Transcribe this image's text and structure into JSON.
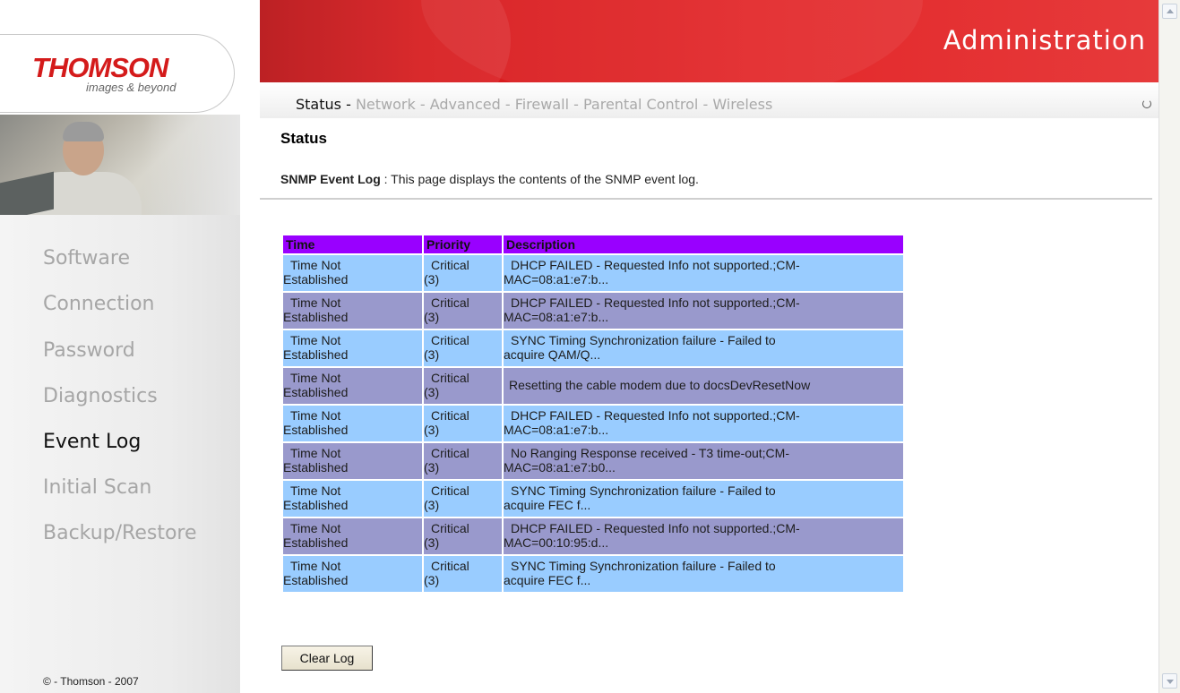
{
  "brand": {
    "logo_text": "THOMSON",
    "tagline": "images & beyond",
    "accent_color": "#d41b1b"
  },
  "header": {
    "title": "Administration"
  },
  "top_nav": {
    "items": [
      {
        "label": "Status",
        "active": true
      },
      {
        "label": "Network",
        "active": false
      },
      {
        "label": "Advanced",
        "active": false
      },
      {
        "label": "Firewall",
        "active": false
      },
      {
        "label": "Parental Control",
        "active": false
      },
      {
        "label": "Wireless",
        "active": false
      }
    ],
    "separator": " - "
  },
  "sidebar": {
    "items": [
      {
        "label": "Software",
        "active": false
      },
      {
        "label": "Connection",
        "active": false
      },
      {
        "label": "Password",
        "active": false
      },
      {
        "label": "Diagnostics",
        "active": false
      },
      {
        "label": "Event Log",
        "active": true
      },
      {
        "label": "Initial Scan",
        "active": false
      },
      {
        "label": "Backup/Restore",
        "active": false
      }
    ],
    "copyright": "© - Thomson - 2007"
  },
  "main": {
    "section_title": "Status",
    "page_name": "SNMP Event Log",
    "page_desc": ":  This page displays the contents of the SNMP event log.",
    "table": {
      "headers": [
        "Time",
        "Priority",
        "Description"
      ],
      "header_color": "#9900ff",
      "row_colors": [
        "#99ccff",
        "#9999cc"
      ],
      "rows": [
        {
          "time": [
            "Time Not",
            "Established"
          ],
          "priority": [
            "Critical",
            "(3)"
          ],
          "description": [
            "DHCP FAILED - Requested Info not supported.;CM-",
            "MAC=08:a1:e7:b..."
          ]
        },
        {
          "time": [
            "Time Not",
            "Established"
          ],
          "priority": [
            "Critical",
            "(3)"
          ],
          "description": [
            "DHCP FAILED - Requested Info not supported.;CM-",
            "MAC=08:a1:e7:b..."
          ]
        },
        {
          "time": [
            "Time Not",
            "Established"
          ],
          "priority": [
            "Critical",
            "(3)"
          ],
          "description": [
            "SYNC Timing Synchronization failure - Failed to",
            "acquire QAM/Q..."
          ]
        },
        {
          "time": [
            "Time Not",
            "Established"
          ],
          "priority": [
            "Critical",
            "(3)"
          ],
          "description": [
            "Resetting the cable modem due to docsDevResetNow"
          ]
        },
        {
          "time": [
            "Time Not",
            "Established"
          ],
          "priority": [
            "Critical",
            "(3)"
          ],
          "description": [
            "DHCP FAILED - Requested Info not supported.;CM-",
            "MAC=08:a1:e7:b..."
          ]
        },
        {
          "time": [
            "Time Not",
            "Established"
          ],
          "priority": [
            "Critical",
            "(3)"
          ],
          "description": [
            "No Ranging Response received - T3 time-out;CM-",
            "MAC=08:a1:e7:b0..."
          ]
        },
        {
          "time": [
            "Time Not",
            "Established"
          ],
          "priority": [
            "Critical",
            "(3)"
          ],
          "description": [
            "SYNC Timing Synchronization failure - Failed to",
            "acquire FEC f..."
          ]
        },
        {
          "time": [
            "Time Not",
            "Established"
          ],
          "priority": [
            "Critical",
            "(3)"
          ],
          "description": [
            "DHCP FAILED - Requested Info not supported.;CM-",
            "MAC=00:10:95:d..."
          ]
        },
        {
          "time": [
            "Time Not",
            "Established"
          ],
          "priority": [
            "Critical",
            "(3)"
          ],
          "description": [
            "SYNC Timing Synchronization failure - Failed to",
            "acquire FEC f..."
          ]
        }
      ]
    },
    "clear_button": "Clear Log"
  }
}
